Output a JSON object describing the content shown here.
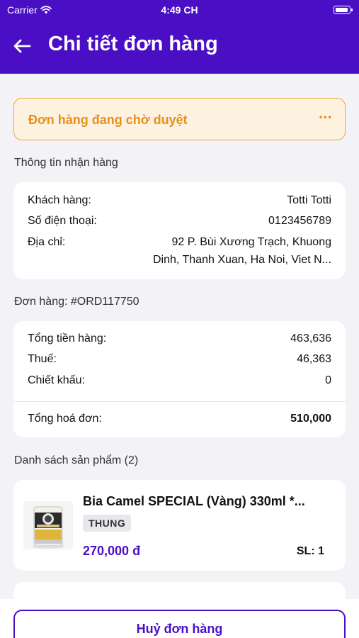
{
  "status_bar": {
    "carrier": "Carrier",
    "time": "4:49 CH"
  },
  "header": {
    "title": "Chi tiết đơn hàng"
  },
  "order_status": {
    "label": "Đơn hàng đang chờ duyệt",
    "more": "···"
  },
  "shipping": {
    "section_title": "Thông tin nhận hàng",
    "customer_label": "Khách hàng:",
    "customer_value": "Totti Totti",
    "phone_label": "Số điện thoại:",
    "phone_value": "0123456789",
    "address_label": "Địa chỉ:",
    "address_line1": "92 P. Bùi Xương Trạch, Khuong",
    "address_line2": "Dinh, Thanh Xuan, Ha Noi, Viet N..."
  },
  "order": {
    "section_title": "Đơn hàng: #ORD117750",
    "subtotal_label": "Tổng tiền hàng:",
    "subtotal_value": "463,636",
    "tax_label": "Thuế:",
    "tax_value": "46,363",
    "discount_label": "Chiết khấu:",
    "discount_value": "0",
    "total_label": "Tổng hoá đơn:",
    "total_value": "510,000"
  },
  "products": {
    "section_title": "Danh sách sản phẩm (2)",
    "items": [
      {
        "name": "Bia Camel SPECIAL (Vàng) 330ml *...",
        "unit": "THUNG",
        "price": "270,000 đ",
        "qty": "SL: 1"
      }
    ]
  },
  "actions": {
    "cancel_label": "Huỷ đơn hàng"
  },
  "colors": {
    "brand": "#4a0fc4",
    "status_orange": "#e88f1a",
    "status_bg": "#fdf2df"
  }
}
